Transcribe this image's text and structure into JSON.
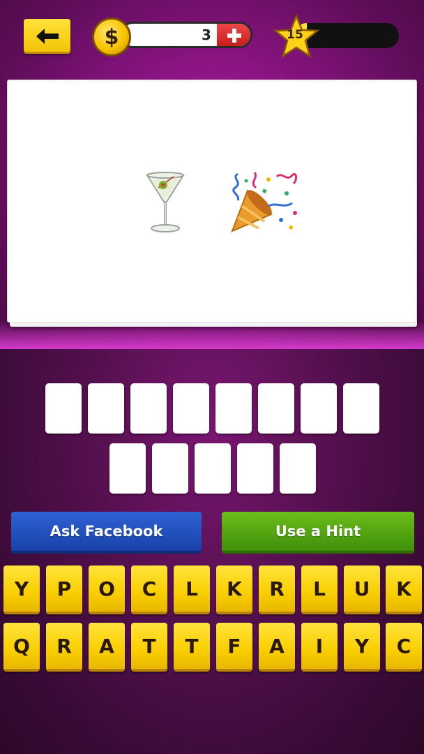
{
  "header": {
    "back_icon": "left-arrow-icon",
    "coins": {
      "icon": "dollar-coin-icon",
      "symbol": "$",
      "count": "3",
      "add_icon": "plus-icon"
    },
    "level": {
      "icon": "star-icon",
      "number": "15",
      "progress": 0.12
    }
  },
  "clue": {
    "emojis": [
      {
        "name": "martini-glass-icon",
        "char": "🍸"
      },
      {
        "name": "party-popper-icon",
        "char": "🎉"
      }
    ]
  },
  "answer": {
    "row1_slots": [
      "",
      "",
      "",
      "",
      "",
      "",
      "",
      ""
    ],
    "row2_slots": [
      "",
      "",
      "",
      "",
      ""
    ]
  },
  "actions": {
    "facebook_label": "Ask Facebook",
    "hint_label": "Use a Hint"
  },
  "keyboard": {
    "row1": [
      "Y",
      "P",
      "O",
      "C",
      "L",
      "K",
      "R",
      "L",
      "U",
      "K"
    ],
    "row2": [
      "Q",
      "R",
      "A",
      "T",
      "T",
      "F",
      "A",
      "I",
      "Y",
      "C"
    ]
  },
  "colors": {
    "background_top": "#8a1482",
    "background_bottom": "#3a0a36",
    "key_yellow": "#f9cf00",
    "facebook_blue": "#2451c0",
    "hint_green": "#53a612",
    "plus_red": "#d82020"
  }
}
